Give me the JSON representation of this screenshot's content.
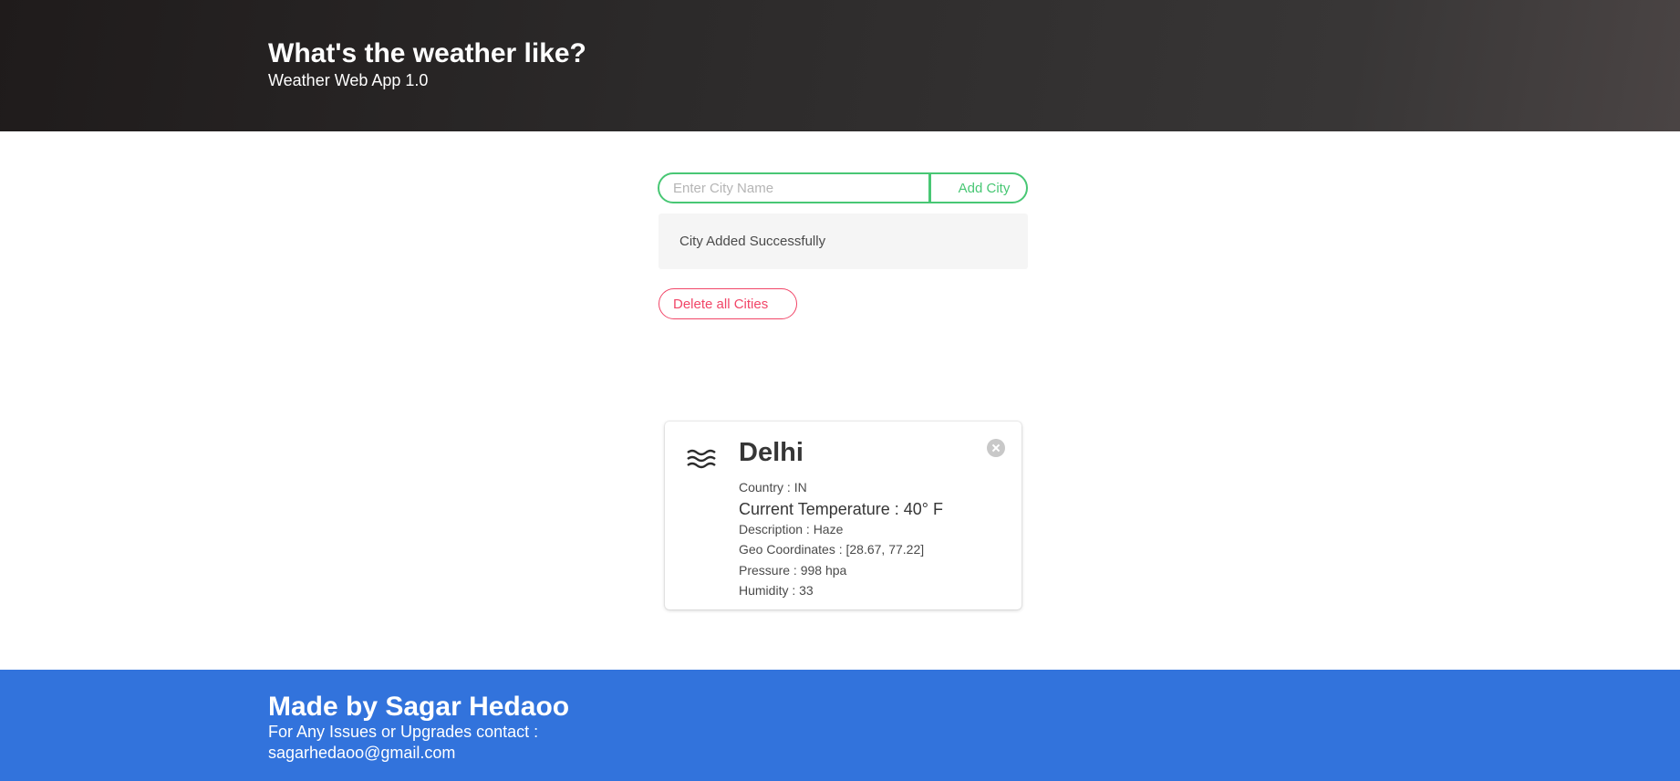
{
  "header": {
    "title": "What's the weather like?",
    "subtitle": "Weather Web App 1.0"
  },
  "form": {
    "placeholder": "Enter City Name",
    "value": "",
    "add_label": "Add City"
  },
  "notification": "City Added Successfully",
  "delete_all_label": "Delete all Cities",
  "card": {
    "icon": "haze-icon",
    "city": "Delhi",
    "country": "Country : IN",
    "temperature": "Current Temperature : 40° F",
    "description": "Description : Haze",
    "coordinates": "Geo Coordinates : [28.67, 77.22]",
    "pressure": "Pressure : 998 hpa",
    "humidity": "Humidity : 33"
  },
  "footer": {
    "title": "Made by Sagar Hedaoo",
    "contact_line": "For Any Issues or Upgrades contact :",
    "email": "sagarhedaoo@gmail.com"
  },
  "colors": {
    "success": "#48c774",
    "danger": "#f14668",
    "footer": "#3273dc"
  }
}
